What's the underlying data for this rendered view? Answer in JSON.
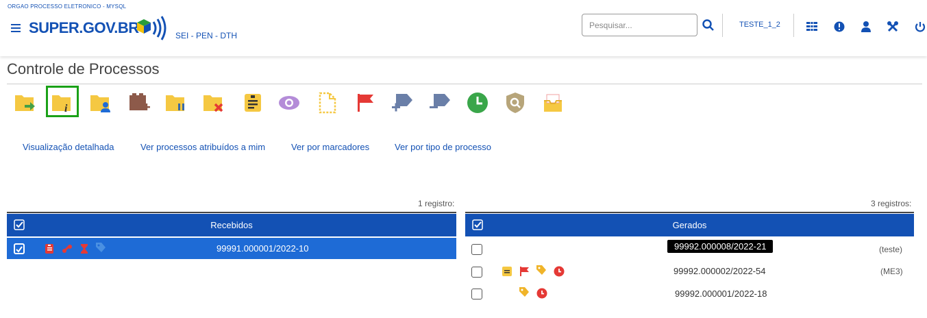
{
  "header": {
    "org_label": "ORGAO PROCESSO ELETRONICO - MYSQL",
    "logo_text": "SUPER.GOV.BR",
    "unit_path": "SEI - PEN - DTH",
    "search_placeholder": "Pesquisar...",
    "current_unit": "TESTE_1_2",
    "brand_color": "#1351b4"
  },
  "page": {
    "title": "Controle de Processos"
  },
  "toolbar": {
    "icons": [
      "send-process-icon",
      "process-info-icon",
      "assign-process-icon",
      "new-document-icon",
      "suspend-process-icon",
      "close-process-icon",
      "notes-icon",
      "acknowledge-icon",
      "sign-document-icon",
      "flag-marker-icon",
      "add-marker-icon",
      "remove-marker-icon",
      "deadline-icon",
      "search-process-icon",
      "archive-icon"
    ],
    "selected_icon": "process-info-icon"
  },
  "nav_links": [
    "Visualização detalhada",
    "Ver processos atribuídos a mim",
    "Ver por marcadores",
    "Ver por tipo de processo"
  ],
  "received": {
    "count": "1 registro:",
    "header": "Recebidos",
    "rows": [
      {
        "process": "99991.000001/2022-10",
        "checked": true,
        "icons": [
          "note-red-icon",
          "link-icon",
          "hourglass-icon",
          "tag-blue-icon"
        ]
      }
    ]
  },
  "generated": {
    "count": "3 registros:",
    "header": "Gerados",
    "rows": [
      {
        "process": "99992.000008/2022-21",
        "annotation": "(teste)",
        "checked": false,
        "highlighted": true,
        "icons": []
      },
      {
        "process": "99992.000002/2022-54",
        "annotation": "(ME3)",
        "checked": false,
        "icons": [
          "note-yellow-icon",
          "flag-icon",
          "tag-yellow-icon",
          "clock-icon"
        ]
      },
      {
        "process": "99992.000001/2022-18",
        "annotation": "",
        "checked": false,
        "icons": [
          "tag-yellow-icon",
          "clock-icon"
        ]
      }
    ]
  }
}
